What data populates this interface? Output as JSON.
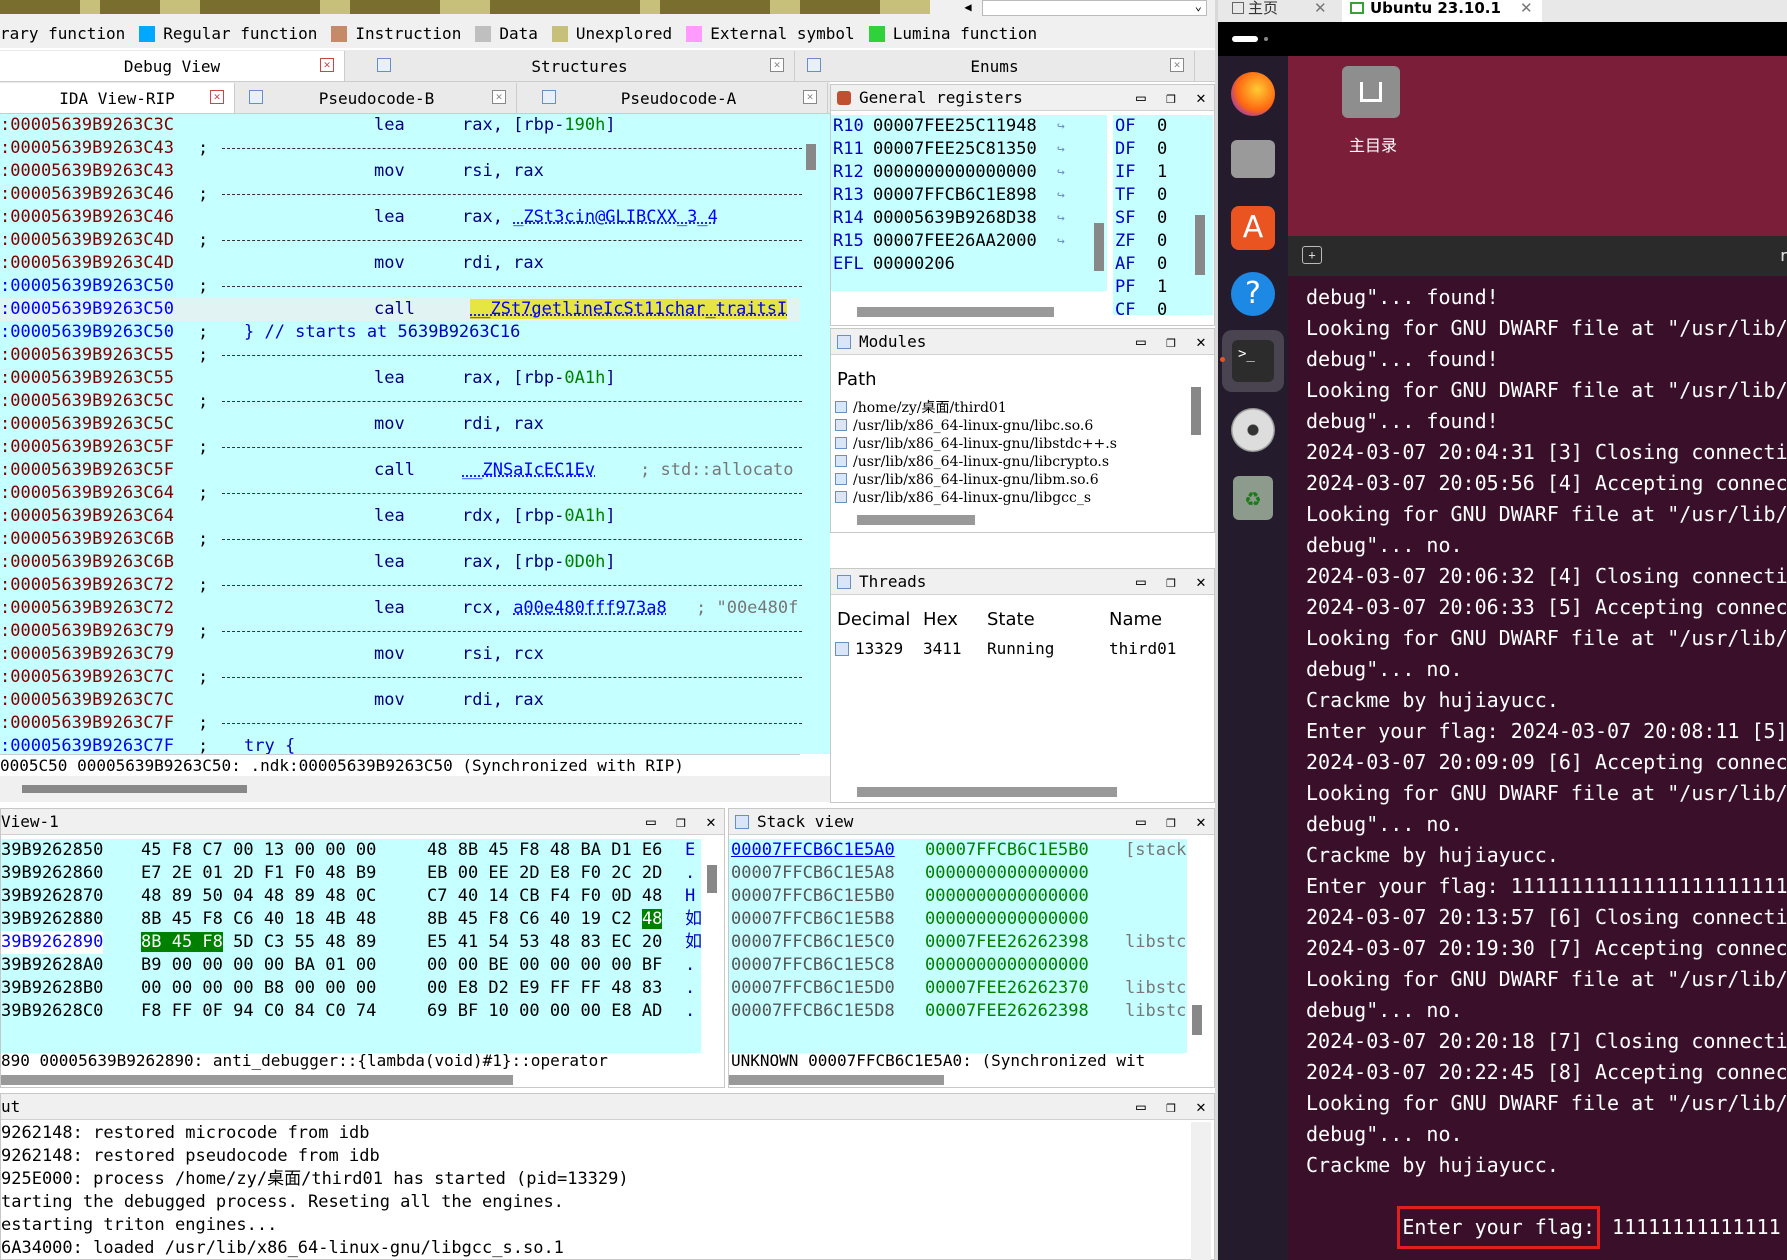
{
  "legend": [
    {
      "label": "rary function",
      "color": null
    },
    {
      "label": "Regular function",
      "color": "#00a8ff"
    },
    {
      "label": "Instruction",
      "color": "#c68a68"
    },
    {
      "label": "Data",
      "color": "#bfbfbf"
    },
    {
      "label": "Unexplored",
      "color": "#c6c07a"
    },
    {
      "label": "External symbol",
      "color": "#ff9aff"
    },
    {
      "label": "Lumina function",
      "color": "#2fd23a"
    }
  ],
  "tabs_top": [
    {
      "label": "Debug View"
    },
    {
      "label": "Structures"
    },
    {
      "label": "Enums"
    }
  ],
  "tabs_second": [
    {
      "label": "IDA View-RIP"
    },
    {
      "label": "Pseudocode-B"
    },
    {
      "label": "Pseudocode-A"
    }
  ],
  "ida_lines": [
    {
      "addr": ":00005639B9263C3C",
      "sep": "",
      "mn": "lea",
      "op": "rax, [rbp-",
      "num": "190h",
      "tail": "]"
    },
    {
      "addr": ":00005639B9263C43",
      "sep": ";",
      "dash": true
    },
    {
      "addr": ":00005639B9263C43",
      "sep": "",
      "mn": "mov",
      "op": "rsi, rax"
    },
    {
      "addr": ":00005639B9263C46",
      "sep": ";",
      "dash": true
    },
    {
      "addr": ":00005639B9263C46",
      "sep": "",
      "mn": "lea",
      "op": "rax, ",
      "sym": "_ZSt3cin@GLIBCXX_3_4"
    },
    {
      "addr": ":00005639B9263C4D",
      "sep": ";",
      "dash": true
    },
    {
      "addr": ":00005639B9263C4D",
      "sep": "",
      "mn": "mov",
      "op": "rdi, rax"
    },
    {
      "addr": ":00005639B9263C50",
      "sep": ";",
      "dash": true,
      "blue": true
    },
    {
      "addr": ":00005639B9263C50",
      "sep": "",
      "mn": "call",
      "sym": "__ZSt7getlineIcSt11char_traitsI",
      "hl": true,
      "blue": true
    },
    {
      "addr": ":00005639B9263C50",
      "sep": ";",
      "comment": "} // starts at 5639B9263C16",
      "blue": true
    },
    {
      "addr": ":00005639B9263C55",
      "sep": ";",
      "dash": true
    },
    {
      "addr": ":00005639B9263C55",
      "sep": "",
      "mn": "lea",
      "op": "rax, [rbp-",
      "num": "0A1h",
      "tail": "]"
    },
    {
      "addr": ":00005639B9263C5C",
      "sep": ";",
      "dash": true
    },
    {
      "addr": ":00005639B9263C5C",
      "sep": "",
      "mn": "mov",
      "op": "rdi, rax"
    },
    {
      "addr": ":00005639B9263C5F",
      "sep": ";",
      "dash": true
    },
    {
      "addr": ":00005639B9263C5F",
      "sep": "",
      "mn": "call",
      "sym": "__ZNSaIcEC1Ev",
      "cm2": "; std::allocato"
    },
    {
      "addr": ":00005639B9263C64",
      "sep": ";",
      "dash": true
    },
    {
      "addr": ":00005639B9263C64",
      "sep": "",
      "mn": "lea",
      "op": "rdx, [rbp-",
      "num": "0A1h",
      "tail": "]"
    },
    {
      "addr": ":00005639B9263C6B",
      "sep": ";",
      "dash": true
    },
    {
      "addr": ":00005639B9263C6B",
      "sep": "",
      "mn": "lea",
      "op": "rax, [rbp-",
      "num": "0D0h",
      "tail": "]"
    },
    {
      "addr": ":00005639B9263C72",
      "sep": ";",
      "dash": true
    },
    {
      "addr": ":00005639B9263C72",
      "sep": "",
      "mn": "lea",
      "op": "rcx, ",
      "sym": "a00e480fff973a8",
      "cm2": "; \"00e480f"
    },
    {
      "addr": ":00005639B9263C79",
      "sep": ";",
      "dash": true
    },
    {
      "addr": ":00005639B9263C79",
      "sep": "",
      "mn": "mov",
      "op": "rsi, rcx"
    },
    {
      "addr": ":00005639B9263C7C",
      "sep": ";",
      "dash": true
    },
    {
      "addr": ":00005639B9263C7C",
      "sep": "",
      "mn": "mov",
      "op": "rdi, rax"
    },
    {
      "addr": ":00005639B9263C7F",
      "sep": ";",
      "dash": true
    },
    {
      "addr": ":00005639B9263C7F",
      "sep": ";",
      "comment": "try {",
      "blue": true
    }
  ],
  "ida_status": "0005C50 00005639B9263C50: .ndk:00005639B9263C50 (Synchronized with RIP)",
  "registers": [
    {
      "name": "R10",
      "value": "00007FEE25C11948"
    },
    {
      "name": "R11",
      "value": "00007FEE25C81350"
    },
    {
      "name": "R12",
      "value": "0000000000000000"
    },
    {
      "name": "R13",
      "value": "00007FFCB6C1E898"
    },
    {
      "name": "R14",
      "value": "00005639B9268D38"
    },
    {
      "name": "R15",
      "value": "00007FEE26AA2000"
    },
    {
      "name": "EFL",
      "value": "00000206"
    }
  ],
  "flags": [
    {
      "name": "OF",
      "value": "0"
    },
    {
      "name": "DF",
      "value": "0"
    },
    {
      "name": "IF",
      "value": "1"
    },
    {
      "name": "TF",
      "value": "0"
    },
    {
      "name": "SF",
      "value": "0"
    },
    {
      "name": "ZF",
      "value": "0"
    },
    {
      "name": "AF",
      "value": "0"
    },
    {
      "name": "PF",
      "value": "1"
    },
    {
      "name": "CF",
      "value": "0"
    }
  ],
  "panels": {
    "registers_title": "General registers",
    "modules_title": "Modules",
    "threads_title": "Threads",
    "hex_title": "View-1",
    "stack_title": "Stack view",
    "output_title": "ut"
  },
  "modules": {
    "header": "Path",
    "items": [
      "/home/zy/桌面/third01",
      "/usr/lib/x86_64-linux-gnu/libc.so.6",
      "/usr/lib/x86_64-linux-gnu/libstdc++.s",
      "/usr/lib/x86_64-linux-gnu/libcrypto.s",
      "/usr/lib/x86_64-linux-gnu/libm.so.6",
      "/usr/lib/x86_64-linux-gnu/libgcc_s"
    ]
  },
  "threads": {
    "headers": [
      "Decimal",
      "Hex",
      "State",
      "Name"
    ],
    "rows": [
      [
        "13329",
        "3411",
        "Running",
        "third01"
      ]
    ]
  },
  "hex_lines": [
    {
      "addr": "39B9262850",
      "bytes1": "45 F8 C7 00 13 00 00 00",
      "bytes2": "48 8B 45 F8 48 BA D1 E6",
      "asc": "E"
    },
    {
      "addr": "39B9262860",
      "bytes1": "E7 2E 01 2D F1 F0 48 B9",
      "bytes2": "EB 00 EE 2D E8 F0 2C 2D",
      "asc": "."
    },
    {
      "addr": "39B9262870",
      "bytes1": "48 89 50 04 48 89 48 0C",
      "bytes2": "C7 40 14 CB F4 F0 0D 48",
      "asc": "H"
    },
    {
      "addr": "39B9262880",
      "bytes1": "8B 45 F8 C6 40 18 4B 48",
      "bytes2": "8B 45 F8 C6 40 19 C2 48",
      "asc": "如"
    },
    {
      "addr": "39B9262890",
      "bytes1": "8B 45 F8 5D C3 55 48 89",
      "bytes2": "E5 41 54 53 48 83 EC 20",
      "asc": "如",
      "hl": true
    },
    {
      "addr": "39B92628A0",
      "bytes1": "B9 00 00 00 00 BA 01 00",
      "bytes2": "00 00 BE 00 00 00 00 BF",
      "asc": "."
    },
    {
      "addr": "39B92628B0",
      "bytes1": "00 00 00 00 B8 00 00 00",
      "bytes2": "00 E8 D2 E9 FF FF 48 83",
      "asc": "."
    },
    {
      "addr": "39B92628C0",
      "bytes1": "F8 FF 0F 94 C0 84 C0 74",
      "bytes2": "69 BF 10 00 00 00 E8 AD",
      "asc": "."
    }
  ],
  "hex_status": "890 00005639B9262890: anti_debugger::{lambda(void)#1}::operator",
  "stack_lines": [
    {
      "addr": "00007FFCB6C1E5A0",
      "val": "00007FFCB6C1E5B0",
      "note": "[stack",
      "hl": true
    },
    {
      "addr": "00007FFCB6C1E5A8",
      "val": "0000000000000000",
      "note": ""
    },
    {
      "addr": "00007FFCB6C1E5B0",
      "val": "0000000000000000",
      "note": ""
    },
    {
      "addr": "00007FFCB6C1E5B8",
      "val": "0000000000000000",
      "note": ""
    },
    {
      "addr": "00007FFCB6C1E5C0",
      "val": "00007FEE26262398",
      "note": "libstc"
    },
    {
      "addr": "00007FFCB6C1E5C8",
      "val": "0000000000000000",
      "note": ""
    },
    {
      "addr": "00007FFCB6C1E5D0",
      "val": "00007FEE26262370",
      "note": "libstc"
    },
    {
      "addr": "00007FFCB6C1E5D8",
      "val": "00007FEE26262398",
      "note": "libstc"
    }
  ],
  "stack_status": "UNKNOWN 00007FFCB6C1E5A0: (Synchronized wit",
  "output_lines": [
    "9262148: restored microcode from idb",
    "9262148: restored pseudocode from idb",
    "925E000: process /home/zy/桌面/third01 has started (pid=13329)",
    "tarting the debugged process. Reseting all the engines.",
    "estarting triton engines...",
    "6A34000: loaded /usr/lib/x86_64-linux-gnu/libgcc_s.so.1"
  ],
  "vm": {
    "tabs": [
      {
        "label": "主页"
      },
      {
        "label": "Ubuntu 23.10.1"
      }
    ],
    "desktop_icon": "主目录",
    "terminal_lines": [
      "debug\"... found!",
      "Looking for GNU DWARF file at \"/usr/lib/de",
      "debug\"... found!",
      "Looking for GNU DWARF file at \"/usr/lib/de",
      "debug\"... found!",
      "2024-03-07 20:04:31 [3] Closing connection",
      "2024-03-07 20:05:56 [4] Accepting connecti",
      "Looking for GNU DWARF file at \"/usr/lib/de",
      "debug\"... no.",
      "2024-03-07 20:06:32 [4] Closing connection",
      "2024-03-07 20:06:33 [5] Accepting connecti",
      "Looking for GNU DWARF file at \"/usr/lib/de",
      "debug\"... no.",
      "Crackme by hujiayucc.",
      "Enter your flag: 2024-03-07 20:08:11 [5] C",
      "2024-03-07 20:09:09 [6] Accepting connecti",
      "Looking for GNU DWARF file at \"/usr/lib/de",
      "debug\"... no.",
      "Crackme by hujiayucc.",
      "Enter your flag: 1111111111111111111111111",
      "2024-03-07 20:13:57 [6] Closing connection",
      "2024-03-07 20:19:30 [7] Accepting connecti",
      "Looking for GNU DWARF file at \"/usr/lib/de",
      "debug\"... no.",
      "2024-03-07 20:20:18 [7] Closing connection",
      "2024-03-07 20:22:45 [8] Accepting connecti",
      "Looking for GNU DWARF file at \"/usr/lib/de",
      "debug\"... no.",
      "Crackme by hujiayucc."
    ],
    "prompt": "Enter your flag:",
    "input": "11111111111111",
    "right_edge_char": "r"
  }
}
